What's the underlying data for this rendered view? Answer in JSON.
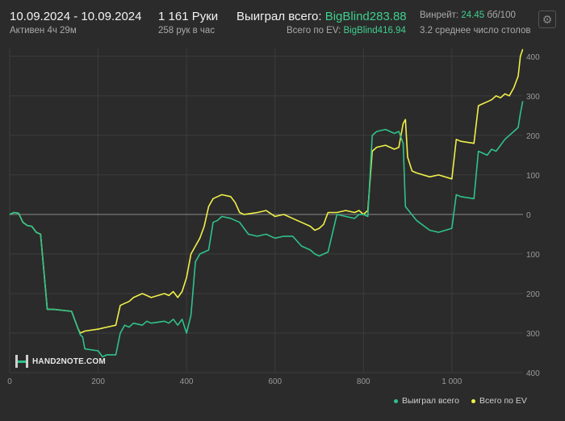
{
  "header": {
    "date_range": "10.09.2024 - 10.09.2024",
    "active_time": "Активен 4ч 29м",
    "hands": "1 161 Руки",
    "hands_per_hour": "258 рук в час",
    "won_label": "Выиграл всего:",
    "won_value": "BigBlind283.88",
    "ev_label": "Всего по EV:",
    "ev_value": "BigBlind416.94",
    "winrate_label": "Винрейт:",
    "winrate_value": "24.45",
    "winrate_unit": "бб/100",
    "avg_tables": "3.2 среднее число столов"
  },
  "logo": {
    "text": "HAND2NOTE.COM",
    "icon": "h2n-logo-icon"
  },
  "settings": {
    "icon": "gear-icon"
  },
  "colors": {
    "won": "#2fc28a",
    "ev": "#f0f04a",
    "background": "#2b2b2b",
    "grid": "#3c3c3c",
    "zero_line": "#8a8a8a"
  },
  "chart_data": {
    "type": "line",
    "xlim": [
      0,
      1161
    ],
    "ylim": [
      -400,
      420
    ],
    "x_ticks": [
      "0",
      "200",
      "400",
      "600",
      "800",
      "1 000"
    ],
    "x_tick_values": [
      0,
      200,
      400,
      600,
      800,
      1000
    ],
    "y_ticks": [
      "400",
      "300",
      "200",
      "100",
      "0",
      "100",
      "200",
      "300",
      "400"
    ],
    "y_tick_values": [
      400,
      300,
      200,
      100,
      0,
      -100,
      -200,
      -300,
      -400
    ],
    "legend_position": "bottom-right",
    "series": [
      {
        "name": "Выиграл всего",
        "color": "#2fc28a",
        "points": [
          [
            0,
            0
          ],
          [
            10,
            5
          ],
          [
            20,
            3
          ],
          [
            30,
            -20
          ],
          [
            40,
            -28
          ],
          [
            50,
            -30
          ],
          [
            60,
            -45
          ],
          [
            70,
            -50
          ],
          [
            85,
            -240
          ],
          [
            100,
            -240
          ],
          [
            140,
            -245
          ],
          [
            155,
            -290
          ],
          [
            160,
            -305
          ],
          [
            165,
            -310
          ],
          [
            170,
            -340
          ],
          [
            200,
            -345
          ],
          [
            210,
            -360
          ],
          [
            220,
            -355
          ],
          [
            240,
            -355
          ],
          [
            250,
            -300
          ],
          [
            260,
            -280
          ],
          [
            270,
            -285
          ],
          [
            280,
            -275
          ],
          [
            300,
            -280
          ],
          [
            310,
            -270
          ],
          [
            320,
            -275
          ],
          [
            350,
            -270
          ],
          [
            360,
            -275
          ],
          [
            370,
            -265
          ],
          [
            380,
            -280
          ],
          [
            390,
            -265
          ],
          [
            400,
            -300
          ],
          [
            410,
            -255
          ],
          [
            420,
            -120
          ],
          [
            430,
            -100
          ],
          [
            440,
            -95
          ],
          [
            450,
            -90
          ],
          [
            460,
            -20
          ],
          [
            470,
            -15
          ],
          [
            480,
            -5
          ],
          [
            500,
            -10
          ],
          [
            520,
            -20
          ],
          [
            530,
            -35
          ],
          [
            540,
            -50
          ],
          [
            560,
            -55
          ],
          [
            580,
            -50
          ],
          [
            600,
            -60
          ],
          [
            620,
            -55
          ],
          [
            640,
            -55
          ],
          [
            660,
            -80
          ],
          [
            680,
            -90
          ],
          [
            690,
            -100
          ],
          [
            700,
            -105
          ],
          [
            720,
            -95
          ],
          [
            740,
            0
          ],
          [
            760,
            -5
          ],
          [
            780,
            -10
          ],
          [
            790,
            0
          ],
          [
            800,
            0
          ],
          [
            810,
            -5
          ],
          [
            820,
            200
          ],
          [
            830,
            210
          ],
          [
            850,
            215
          ],
          [
            870,
            205
          ],
          [
            880,
            210
          ],
          [
            890,
            180
          ],
          [
            895,
            20
          ],
          [
            920,
            -15
          ],
          [
            950,
            -40
          ],
          [
            970,
            -45
          ],
          [
            1000,
            -35
          ],
          [
            1010,
            50
          ],
          [
            1020,
            45
          ],
          [
            1050,
            40
          ],
          [
            1060,
            160
          ],
          [
            1070,
            155
          ],
          [
            1080,
            150
          ],
          [
            1090,
            165
          ],
          [
            1100,
            160
          ],
          [
            1110,
            175
          ],
          [
            1120,
            190
          ],
          [
            1130,
            200
          ],
          [
            1140,
            210
          ],
          [
            1150,
            220
          ],
          [
            1155,
            255
          ],
          [
            1160,
            285
          ],
          [
            1161,
            283.88
          ]
        ]
      },
      {
        "name": "Всего по EV",
        "color": "#f0f04a",
        "points": [
          [
            0,
            0
          ],
          [
            10,
            5
          ],
          [
            20,
            3
          ],
          [
            30,
            -20
          ],
          [
            40,
            -28
          ],
          [
            50,
            -30
          ],
          [
            60,
            -45
          ],
          [
            70,
            -50
          ],
          [
            85,
            -240
          ],
          [
            100,
            -240
          ],
          [
            140,
            -245
          ],
          [
            155,
            -290
          ],
          [
            160,
            -300
          ],
          [
            170,
            -295
          ],
          [
            200,
            -290
          ],
          [
            220,
            -285
          ],
          [
            240,
            -280
          ],
          [
            250,
            -230
          ],
          [
            260,
            -225
          ],
          [
            270,
            -220
          ],
          [
            280,
            -210
          ],
          [
            300,
            -200
          ],
          [
            310,
            -205
          ],
          [
            320,
            -210
          ],
          [
            350,
            -200
          ],
          [
            360,
            -205
          ],
          [
            370,
            -195
          ],
          [
            380,
            -210
          ],
          [
            390,
            -195
          ],
          [
            400,
            -160
          ],
          [
            410,
            -100
          ],
          [
            420,
            -80
          ],
          [
            430,
            -60
          ],
          [
            440,
            -30
          ],
          [
            450,
            20
          ],
          [
            460,
            40
          ],
          [
            470,
            45
          ],
          [
            480,
            50
          ],
          [
            500,
            45
          ],
          [
            510,
            30
          ],
          [
            520,
            5
          ],
          [
            530,
            0
          ],
          [
            560,
            5
          ],
          [
            580,
            10
          ],
          [
            600,
            -5
          ],
          [
            620,
            0
          ],
          [
            640,
            -10
          ],
          [
            650,
            -15
          ],
          [
            660,
            -20
          ],
          [
            680,
            -30
          ],
          [
            690,
            -40
          ],
          [
            700,
            -35
          ],
          [
            710,
            -25
          ],
          [
            720,
            5
          ],
          [
            740,
            5
          ],
          [
            760,
            10
          ],
          [
            780,
            5
          ],
          [
            790,
            10
          ],
          [
            800,
            0
          ],
          [
            810,
            10
          ],
          [
            820,
            160
          ],
          [
            830,
            170
          ],
          [
            850,
            175
          ],
          [
            870,
            165
          ],
          [
            880,
            170
          ],
          [
            890,
            230
          ],
          [
            895,
            240
          ],
          [
            900,
            145
          ],
          [
            910,
            110
          ],
          [
            920,
            105
          ],
          [
            950,
            95
          ],
          [
            970,
            100
          ],
          [
            1000,
            90
          ],
          [
            1010,
            190
          ],
          [
            1020,
            185
          ],
          [
            1050,
            180
          ],
          [
            1060,
            275
          ],
          [
            1070,
            280
          ],
          [
            1080,
            285
          ],
          [
            1090,
            290
          ],
          [
            1100,
            300
          ],
          [
            1110,
            295
          ],
          [
            1120,
            305
          ],
          [
            1130,
            300
          ],
          [
            1140,
            320
          ],
          [
            1150,
            350
          ],
          [
            1155,
            400
          ],
          [
            1160,
            417
          ],
          [
            1161,
            416.94
          ]
        ]
      }
    ]
  }
}
